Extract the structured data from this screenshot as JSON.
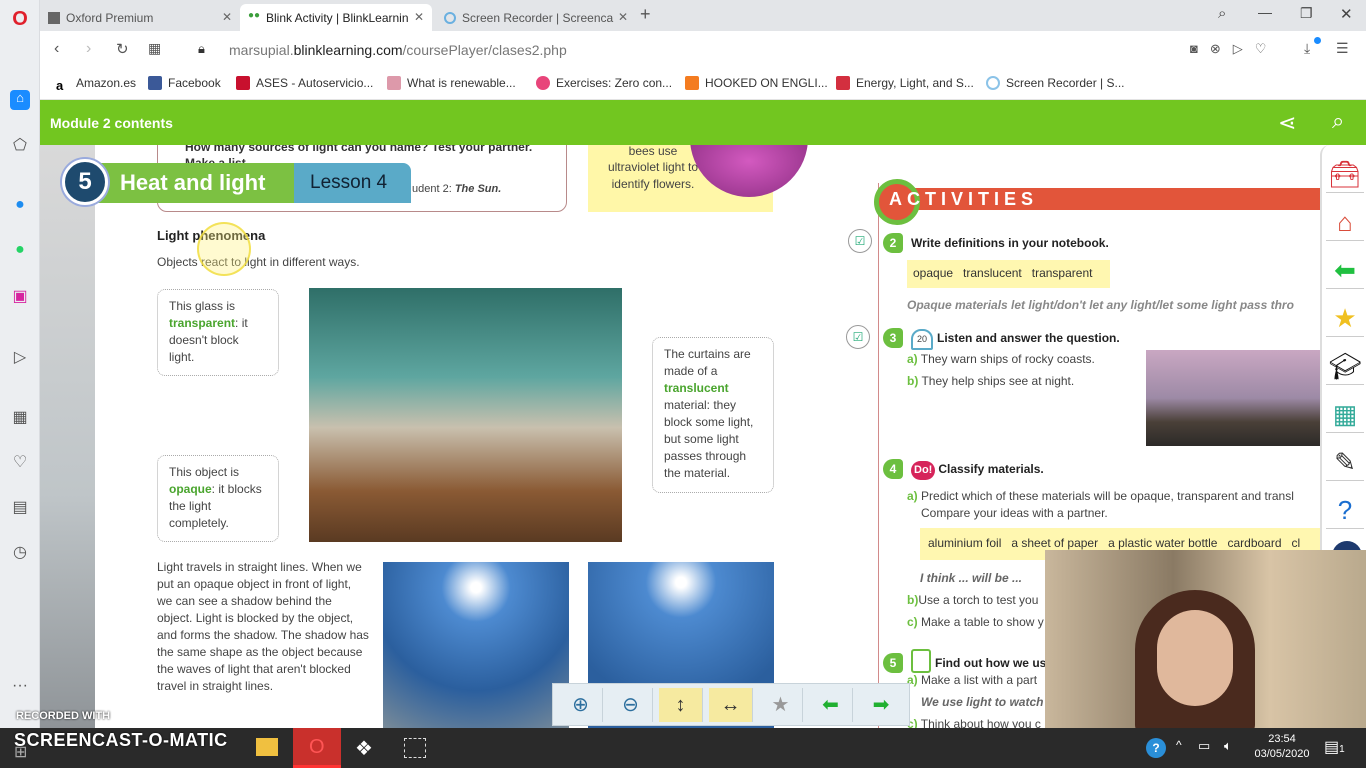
{
  "browser": {
    "tabs": [
      {
        "label": "Oxford Premium",
        "active": false
      },
      {
        "label": "Blink Activity | BlinkLearnin",
        "active": true
      },
      {
        "label": "Screen Recorder | Screenca",
        "active": false
      }
    ],
    "url_host": "marsupial.",
    "url_domain": "blinklearning.com",
    "url_path": "/coursePlayer/clases2.php",
    "bookmarks": [
      "Amazon.es",
      "Facebook",
      "ASES - Autoservicio...",
      "What is renewable...",
      "Exercises: Zero con...",
      "HOOKED ON ENGLI...",
      "Energy, Light, and S...",
      "Screen Recorder | S..."
    ]
  },
  "header": {
    "title": "Module 2 contents"
  },
  "unit": {
    "number": "5",
    "title": "Heat and light",
    "lesson": "Lesson 4"
  },
  "page": {
    "top_question": "How many sources of light can you name? Test your partner.",
    "top_make_list": "Make a list.",
    "top_student": "udent 2: ",
    "top_student_answer": "The Sun.",
    "bees_line1": "bees use",
    "bees_rest": "ultraviolet light to identify flowers.",
    "section_title": "Light phenomena",
    "section_intro": "Objects react to light in different ways.",
    "glass_pre": "This glass is ",
    "glass_term": "transparent",
    "glass_post": ": it doesn't block light.",
    "object_pre": "This object is ",
    "object_term": "opaque",
    "object_post": ": it blocks the light completely.",
    "curtain_pre": "The curtains are made of a ",
    "curtain_term": "translucent",
    "curtain_post": " material: they block some light, but some light passes through the material.",
    "straight_text": "Light travels in straight lines. When we put an opaque object in front of light, we can see a shadow behind the object. Light is blocked by the object, and forms the shadow. The shadow has the same shape as the object because the waves of light that aren't blocked travel in straight lines."
  },
  "activities": {
    "title": "ACTIVITIES",
    "a2": {
      "num": "2",
      "title": "Write definitions in your notebook.",
      "words": "opaque   translucent   transparent",
      "sentence": "Opaque materials let light/don't let any light/let some light pass thro"
    },
    "a3": {
      "num": "3",
      "track": "20",
      "title": "Listen and answer the question.",
      "a": "They warn ships of rocky coasts.",
      "b": "They help ships see at night."
    },
    "a4": {
      "num": "4",
      "badge": "Do!",
      "title": "Classify materials.",
      "a": "Predict which of these materials will be opaque, transparent and transl",
      "a2": "Compare your ideas with a partner.",
      "words": "aluminium foil   a sheet of paper   a plastic water bottle   cardboard   cl",
      "think": "I think ... will be ...",
      "b": "Use a torch to test you",
      "c": "Make a table to show y"
    },
    "a5": {
      "num": "5",
      "title": "Find out how we us",
      "a": "Make a list with a part",
      "example": "We use light to watch",
      "c": "Think about how you c"
    }
  },
  "watermark": {
    "recorded": "RECORDED WITH",
    "brand": "SCREENCAST-O-MATIC"
  },
  "taskbar": {
    "time": "23:54",
    "date": "03/05/2020",
    "notifications": "1"
  },
  "colors": {
    "header_green": "#72c620",
    "activities_red": "#e2553a",
    "term_green": "#4aa52e"
  }
}
